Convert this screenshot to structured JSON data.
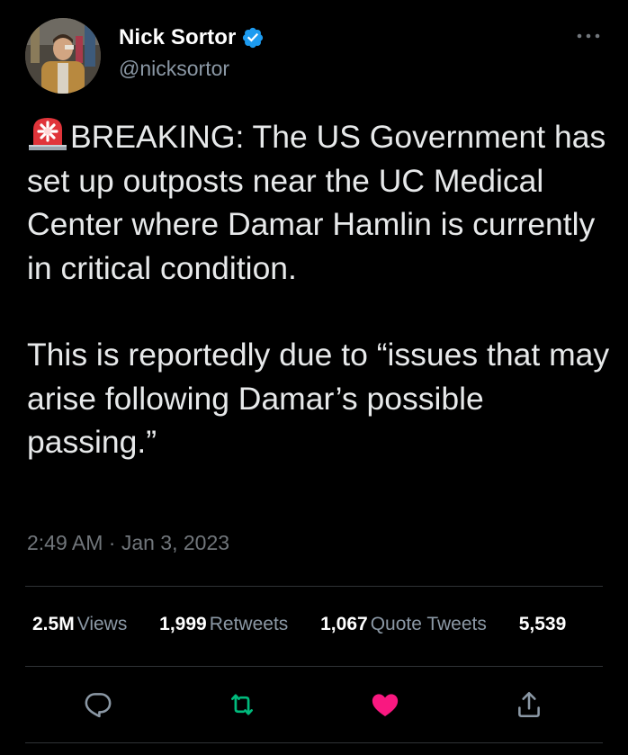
{
  "author": {
    "display_name": "Nick Sortor",
    "handle": "@nicksortor",
    "verified": true
  },
  "tweet": {
    "emoji_icon": "police-siren-icon",
    "paragraph1": "BREAKING: The US Government has set up outposts near the UC Medical Center where Damar Hamlin is currently in critical condition.",
    "paragraph2": "This is reportedly due to “issues that may arise following Damar’s possible passing.”",
    "timestamp": "2:49 AM · Jan 3, 2023"
  },
  "stats": [
    {
      "count": "2.5M",
      "label": "Views"
    },
    {
      "count": "1,999",
      "label": "Retweets"
    },
    {
      "count": "1,067",
      "label": "Quote Tweets"
    },
    {
      "count": "5,539",
      "label": ""
    }
  ],
  "actions": {
    "reply": "reply-icon",
    "retweet": "retweet-icon",
    "like": "like-icon",
    "share": "share-icon"
  },
  "colors": {
    "background": "#000000",
    "text": "#e7e9ea",
    "secondary": "#8b98a5",
    "verified_blue": "#1d9bf0",
    "retweet_green": "#00ba7c",
    "like_pink": "#f91880",
    "siren_red": "#e0343a",
    "divider": "#2f3336"
  }
}
